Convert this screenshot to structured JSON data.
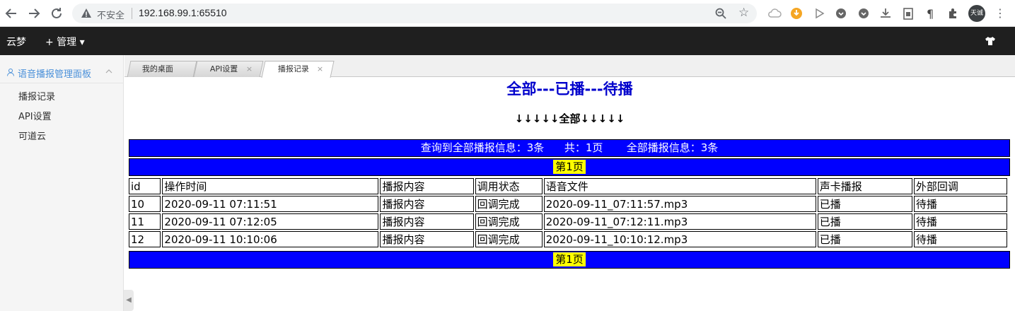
{
  "browser": {
    "insecure_label": "不安全",
    "url": "192.168.99.1:65510",
    "avatar_label": "天诚"
  },
  "header": {
    "app_title": "云梦",
    "manage_label": "+ 管理 ▾"
  },
  "sidebar": {
    "section_label": "语音播报管理面板",
    "items": [
      {
        "label": "播报记录"
      },
      {
        "label": "API设置"
      },
      {
        "label": "可道云"
      }
    ]
  },
  "tabs": [
    {
      "label": "我的桌面",
      "closable": false,
      "active": false
    },
    {
      "label": "API设置",
      "closable": true,
      "active": false
    },
    {
      "label": "播报记录",
      "closable": true,
      "active": true
    }
  ],
  "tab_close_glyph": "×",
  "main": {
    "headline": "全部---已播---待播",
    "arrows_line": "↓↓↓↓↓全部↓↓↓↓↓",
    "summary": "查询到全部播报信息：3条      共：1页       全部播报信息：3条",
    "page_label": "第1页",
    "columns": [
      "id",
      "操作时间",
      "播报内容",
      "调用状态",
      "语音文件",
      "声卡播报",
      "外部回调"
    ],
    "rows": [
      [
        "10",
        "2020-09-11 07:11:51",
        "播报内容",
        "回调完成",
        "2020-09-11_07:11:57.mp3",
        "已播",
        "待播"
      ],
      [
        "11",
        "2020-09-11 07:12:05",
        "播报内容",
        "回调完成",
        "2020-09-11_07:12:11.mp3",
        "已播",
        "待播"
      ],
      [
        "12",
        "2020-09-11 10:10:06",
        "播报内容",
        "回调完成",
        "2020-09-11_10:10:12.mp3",
        "已播",
        "待播"
      ]
    ]
  },
  "colors": {
    "bar_blue": "#0000ff",
    "headline_blue": "#0000cc",
    "page_badge_yellow": "#ffff00",
    "header_dark": "#1f1f1f",
    "sidebar_accent": "#4a90d9"
  },
  "icons": [
    "back-arrow-icon",
    "forward-arrow-icon",
    "reload-icon",
    "warning-icon",
    "zoom-icon",
    "star-icon",
    "extension-icon",
    "menu-dots-icon",
    "shirt-icon",
    "user-icon",
    "chevron-up-icon",
    "close-icon"
  ]
}
